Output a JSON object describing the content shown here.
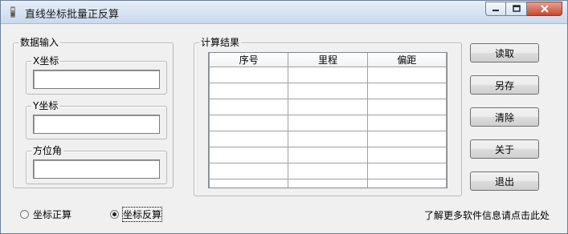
{
  "window": {
    "title": "直线坐标批量正反算"
  },
  "data_input": {
    "group_label": "数据输入",
    "x_label": "X坐标",
    "x_value": "",
    "y_label": "Y坐标",
    "y_value": "",
    "azimuth_label": "方位角",
    "azimuth_value": ""
  },
  "results": {
    "group_label": "计算结果",
    "columns": [
      "序号",
      "里程",
      "偏距"
    ]
  },
  "buttons": {
    "read": "读取",
    "save_as": "另存",
    "clear": "清除",
    "about": "关于",
    "exit": "退出"
  },
  "mode": {
    "forward_label": "坐标正算",
    "inverse_label": "坐标反算",
    "selected": "inverse"
  },
  "footer": {
    "more_info": "了解更多软件信息请点击此处"
  }
}
